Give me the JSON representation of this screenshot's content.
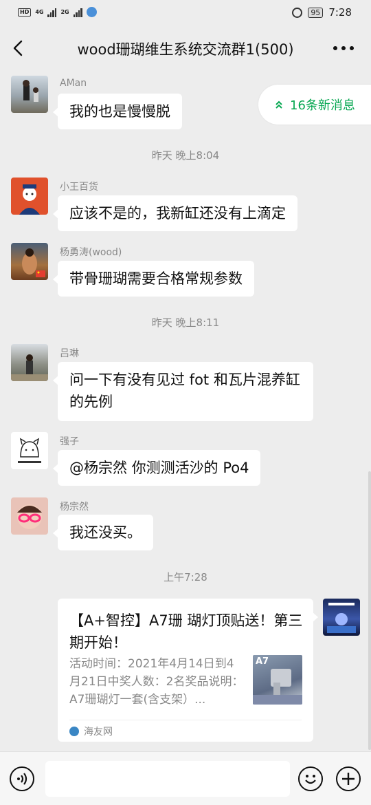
{
  "status_bar": {
    "left_badges": [
      "HD",
      "4G",
      "2G"
    ],
    "battery": "95",
    "time": "7:28"
  },
  "header": {
    "title": "wood珊瑚维生系统交流群1(500)",
    "back_icon": "chevron-left-icon",
    "more_icon": "more-dots-icon"
  },
  "new_messages_pill": {
    "label": "16条新消息",
    "icon": "double-chevron-up-icon",
    "color": "#07a752"
  },
  "messages": [
    {
      "sender": "AMan",
      "text": "我的也是慢慢脱"
    },
    {
      "timestamp": "昨天 晚上8:04"
    },
    {
      "sender": "小王百货",
      "text": "应该不是的，我新缸还没有上滴定"
    },
    {
      "sender": "杨勇涛(wood)",
      "text": "带骨珊瑚需要合格常规参数"
    },
    {
      "timestamp": "昨天 晚上8:11"
    },
    {
      "sender": "吕琳",
      "text": "问一下有没有见过 fot 和瓦片混养缸的先例"
    },
    {
      "sender": "强子",
      "text": "@杨宗然  你测测活沙的 Po4"
    },
    {
      "sender": "杨宗然",
      "text": "我还没买。"
    },
    {
      "timestamp": "上午7:28"
    }
  ],
  "link_card": {
    "title": "【A+智控】A7珊 瑚灯顶贴送！第三期开始！",
    "description": "活动时间：2021年4月14日到4月21日中奖人数：2名奖品说明：A7珊瑚灯一套(含支架）...",
    "thumb_label": "A7",
    "source": "海友网"
  },
  "input_bar": {
    "voice_icon": "voice-icon",
    "emoji_icon": "emoji-icon",
    "plus_icon": "plus-icon",
    "value": ""
  }
}
